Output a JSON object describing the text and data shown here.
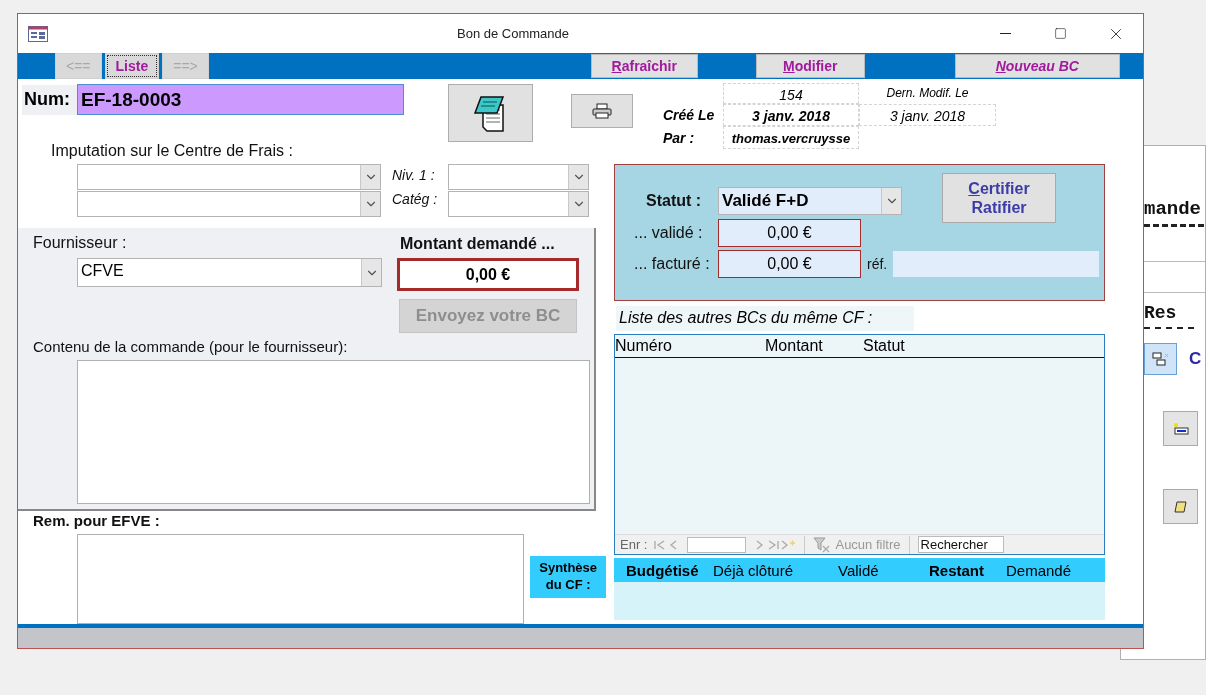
{
  "window": {
    "title": "Bon de Commande"
  },
  "toolbar": {
    "nav": [
      {
        "label": "<==",
        "disabled": true
      },
      {
        "label": "Liste",
        "disabled": false
      },
      {
        "label": "==>",
        "disabled": true
      }
    ],
    "actions": [
      {
        "label": "Rafraîchir",
        "italic": false
      },
      {
        "label": "Modifier",
        "italic": false
      },
      {
        "label": "Nouveau BC",
        "italic": true
      }
    ]
  },
  "num": {
    "label": "Num:",
    "value": "EF-18-0003"
  },
  "info": {
    "number": "154",
    "modified_label": "Dern. Modif. Le",
    "created_label": "Créé Le",
    "created": "3 janv. 2018",
    "modified": "3 janv. 2018",
    "by_label": "Par :",
    "by": "thomas.vercruysse"
  },
  "imputation": {
    "label": "Imputation sur le Centre de Frais :",
    "niv1_label": "Niv. 1 :",
    "categ_label": "Catég :"
  },
  "supplier": {
    "label": "Fournisseur :",
    "value": "CFVE",
    "amount_label": "Montant demandé ...",
    "amount": "0,00 €",
    "send_button": {
      "label": "Envoyez votre BC",
      "disabled": true
    },
    "content_label": "Contenu de la commande (pour le fournisseur):"
  },
  "remark": {
    "label": "Rem. pour EFVE :"
  },
  "status": {
    "label": "Statut :",
    "value": "Validé F+D",
    "button_lines": [
      "Certifier",
      "Ratifier"
    ],
    "validated_label": "... validé :",
    "validated": "0,00 €",
    "invoiced_label": "... facturé :",
    "invoiced": "0,00 €",
    "ref_label": "réf."
  },
  "list": {
    "title": "Liste des autres BCs du même CF :",
    "columns": [
      "Numéro",
      "Montant",
      "Statut"
    ],
    "nav_label": "Enr :",
    "filter": "Aucun filtre",
    "search_placeholder": "Rechercher"
  },
  "synthesis": {
    "label": "Synthèse du CF :",
    "columns": [
      {
        "label": "Budgétisé",
        "bold": true
      },
      {
        "label": "Déjà clôturé",
        "bold": false
      },
      {
        "label": "Validé",
        "bold": false
      },
      {
        "label": "Restant",
        "bold": true
      },
      {
        "label": "Demandé",
        "bold": false
      }
    ]
  },
  "background_window": {
    "heading_1": "mande",
    "heading_2": "Res",
    "link": "C"
  }
}
